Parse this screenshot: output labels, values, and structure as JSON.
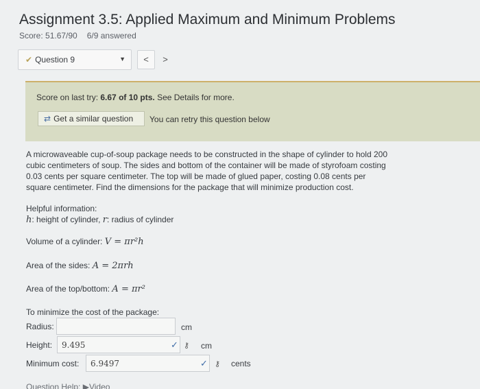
{
  "header": {
    "title": "Assignment 3.5: Applied Maximum and Minimum Problems",
    "score": "Score: 51.67/90",
    "answered": "6/9 answered"
  },
  "nav": {
    "question_label": "Question 9",
    "prev_symbol": "<",
    "next_symbol": ">"
  },
  "score_panel": {
    "prefix": "Score on last try: ",
    "score_bold": "6.67 of 10 pts.",
    "suffix": " See Details for more.",
    "similar_button": "Get a similar question",
    "retry_text": "You can retry this question below"
  },
  "problem": {
    "lines": [
      "A microwaveable cup-of-soup package needs to be constructed in the shape of cylinder to hold 200",
      "cubic centimeters of soup. The sides and bottom of the container will be made of styrofoam costing",
      "0.03 cents per square centimeter. The top will be made of glued paper, costing 0.08 cents per",
      "square centimeter. Find the dimensions for the package that will minimize production cost."
    ],
    "helpful_title": "Helpful information:",
    "helpful_vars": {
      "h": "h",
      "h_text": ": height of cylinder, ",
      "r": "r",
      "r_text": ": radius of cylinder"
    },
    "volume_label": "Volume of a cylinder: ",
    "volume_formula": "V = πr²h",
    "sides_label": "Area of the sides: ",
    "sides_formula": "A = 2πrh",
    "top_label": "Area of the top/bottom: ",
    "top_formula": "A = πr²",
    "minimize_label": "To minimize the cost of the package:"
  },
  "answers": {
    "radius_label": "Radius:",
    "radius_value": "",
    "radius_unit": "cm",
    "height_label": "Height:",
    "height_value": "9.495",
    "height_unit": "cm",
    "cost_label": "Minimum cost:",
    "cost_value": "6.9497",
    "cost_unit": "cents"
  },
  "footer": {
    "help_label": "Question Help:",
    "video_label": "Video"
  }
}
